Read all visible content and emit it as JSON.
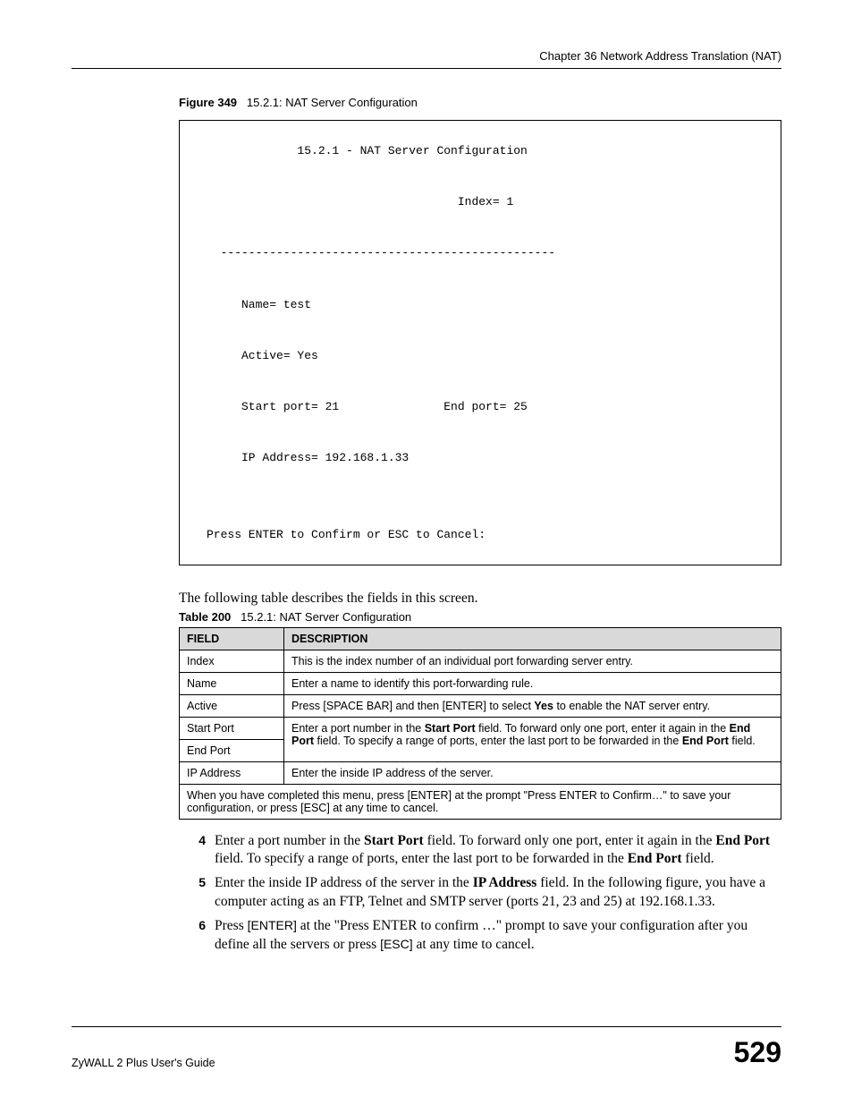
{
  "header": {
    "chapter": "Chapter 36 Network Address Translation (NAT)"
  },
  "figure": {
    "label": "Figure 349",
    "title": "15.2.1: NAT Server Configuration"
  },
  "terminal": {
    "text": "             15.2.1 - NAT Server Configuration\n\n                                    Index= 1\n\n  ------------------------------------------------\n\n     Name= test\n\n     Active= Yes\n\n     Start port= 21               End port= 25\n\n     IP Address= 192.168.1.33\n\n\nPress ENTER to Confirm or ESC to Cancel:"
  },
  "intro": "The following table describes the fields in this screen.",
  "table": {
    "label": "Table 200",
    "title": "15.2.1: NAT Server Configuration",
    "header_field": "FIELD",
    "header_desc": "DESCRIPTION",
    "rows": [
      {
        "field": "Index",
        "desc_html": "This is the index number of an individual port forwarding server entry."
      },
      {
        "field": "Name",
        "desc_html": "Enter a name to identify this port-forwarding rule."
      },
      {
        "field": "Active",
        "desc_html": "Press [SPACE BAR] and then [ENTER] to select <b>Yes</b> to enable the NAT server entry."
      },
      {
        "field": "Start Port",
        "desc_html": ""
      },
      {
        "field": "End Port",
        "desc_html": ""
      },
      {
        "field": "IP Address",
        "desc_html": "Enter the inside IP address of the server."
      }
    ],
    "port_desc_html": "Enter a port number in the <b>Start Port</b> field. To forward only one port, enter it again in the <b>End Port</b> field. To specify a range of ports, enter the last port to be forwarded in the <b>End Port</b> field.",
    "footer_row": "When you have completed this menu, press [ENTER] at the prompt \"Press ENTER to Confirm…\" to save your configuration, or press [ESC] at any time to cancel."
  },
  "steps": [
    {
      "num": "4",
      "html": "Enter a port number in the <b>Start Port</b> field. To forward only one port, enter it again in the <b>End Port</b> field. To specify a range of ports, enter the last port to be forwarded in the <b>End Port</b> field."
    },
    {
      "num": "5",
      "html": "Enter the inside IP address of the server in the <b>IP Address</b> field. In the following figure, you have a computer acting as an FTP, Telnet and SMTP server (ports 21, 23 and 25) at 192.168.1.33."
    },
    {
      "num": "6",
      "html": "Press <span class=\"sf\">[ENTER]</span> at the \"Press ENTER to confirm …\" prompt to save your configuration after you define all the servers or press <span class=\"sf\">[ESC]</span> at any time to cancel."
    }
  ],
  "footer": {
    "guide": "ZyWALL 2 Plus User's Guide",
    "page": "529"
  }
}
